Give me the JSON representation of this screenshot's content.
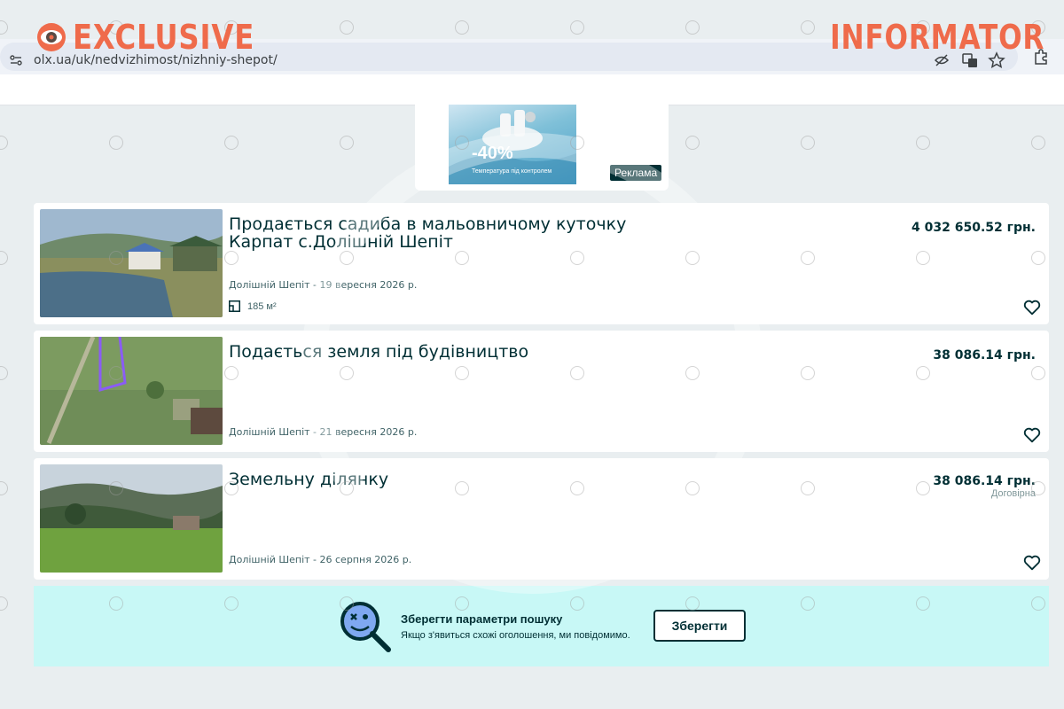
{
  "brand": {
    "left": "EXCLUSIVE",
    "right": "INFORMATOR"
  },
  "browser": {
    "url": "olx.ua/uk/nedvizhimost/nizhniy-shepot/"
  },
  "ad": {
    "discount": "-40%",
    "caption": "Температура під контролем",
    "label": "Реклама"
  },
  "listings": [
    {
      "title": "Продається садиба в мальовничому куточку Карпат с.Долішній Шепіт",
      "price": "4 032 650.52 грн.",
      "location_date": "Долішній Шепіт - 19 вересня 2026 р.",
      "area": "185 м²"
    },
    {
      "title": "Подається земля під будівництво",
      "price": "38 086.14 грн.",
      "location_date": "Долішній Шепіт - 21 вересня 2026 р."
    },
    {
      "title": "Земельну ділянку",
      "price": "38 086.14 грн.",
      "negotiable": "Договірна",
      "location_date": "Долішній Шепіт - 26 серпня 2026 р."
    }
  ],
  "save_search": {
    "title": "Зберегти параметри пошуку",
    "subtitle": "Якщо з'явиться схожі оголошення, ми повідомимо.",
    "button": "Зберегти"
  },
  "colors": {
    "brand": "#ef6b4b",
    "olx_dark": "#002f34",
    "save_bg": "#c8f8f6"
  }
}
